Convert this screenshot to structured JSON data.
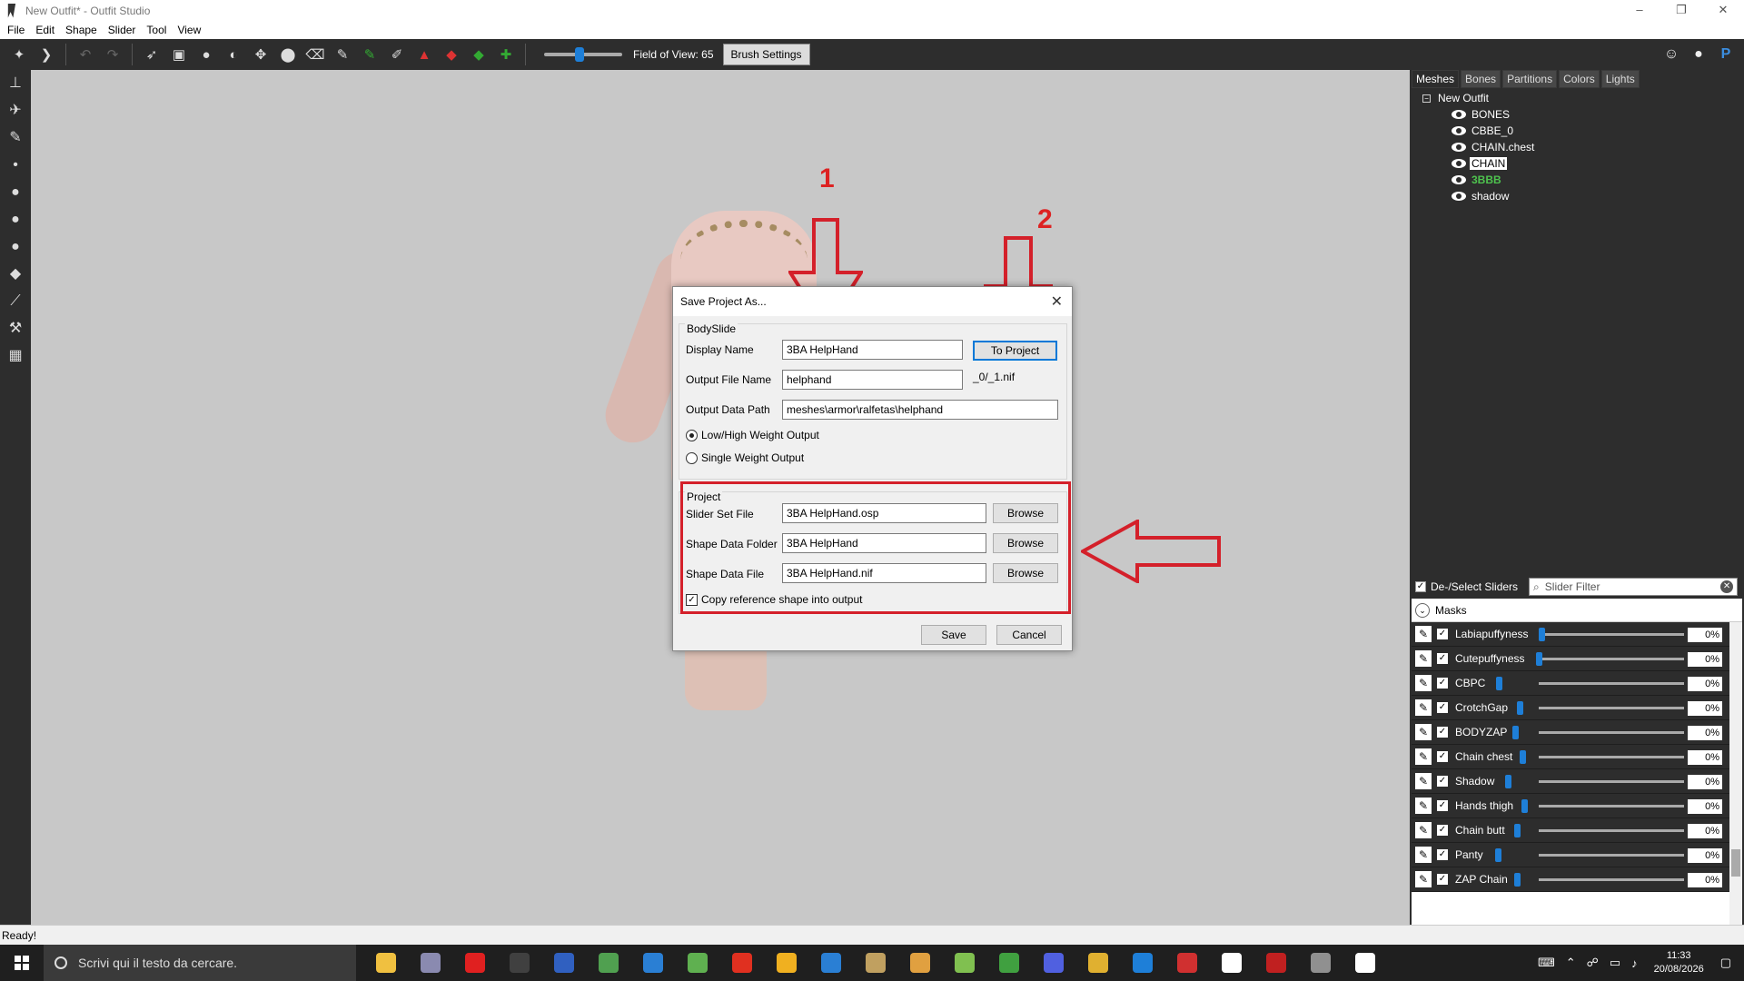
{
  "window": {
    "title": "New Outfit* - Outfit Studio",
    "minimize": "–",
    "restore": "❐",
    "close": "✕"
  },
  "menu": [
    "File",
    "Edit",
    "Shape",
    "Slider",
    "Tool",
    "View"
  ],
  "toolbar": {
    "fov_label": "Field of View: 65",
    "fov_value": 65,
    "brush_settings": "Brush Settings"
  },
  "tabs": [
    "Meshes",
    "Bones",
    "Partitions",
    "Colors",
    "Lights"
  ],
  "active_tab": "Meshes",
  "mesh_tree": {
    "root": "New Outfit",
    "meshes": [
      {
        "name": "BONES",
        "state": "normal"
      },
      {
        "name": "CBBE_0",
        "state": "normal"
      },
      {
        "name": "CHAIN.chest",
        "state": "normal"
      },
      {
        "name": "CHAIN",
        "state": "selected"
      },
      {
        "name": "3BBB",
        "state": "green"
      },
      {
        "name": "shadow",
        "state": "normal"
      }
    ]
  },
  "slider_panel": {
    "select_label": "De-/Select Sliders",
    "filter_placeholder": "Slider Filter",
    "masks_label": "Masks",
    "sliders": [
      {
        "name": "Labiapuffyness",
        "value": "0%",
        "pos": 0
      },
      {
        "name": "Cutepuffyness",
        "value": "0%",
        "pos": 0
      },
      {
        "name": "CBPC",
        "value": "0%",
        "pos": 0
      },
      {
        "name": "CrotchGap",
        "value": "0%",
        "pos": 0
      },
      {
        "name": "BODYZAP",
        "value": "0%",
        "pos": 0
      },
      {
        "name": "Chain chest",
        "value": "0%",
        "pos": 0
      },
      {
        "name": "Shadow",
        "value": "0%",
        "pos": 0
      },
      {
        "name": "Hands thigh",
        "value": "0%",
        "pos": 0
      },
      {
        "name": "Chain butt",
        "value": "0%",
        "pos": 0
      },
      {
        "name": "Panty",
        "value": "0%",
        "pos": 0
      },
      {
        "name": "ZAP Chain",
        "value": "0%",
        "pos": 0
      }
    ]
  },
  "status": {
    "text": "Ready!"
  },
  "dialog": {
    "title": "Save Project As...",
    "bodyslide_group": "BodySlide",
    "display_name_label": "Display Name",
    "display_name_value": "3BA HelpHand",
    "to_project": "To Project",
    "output_file_label": "Output File Name",
    "output_file_value": "helphand",
    "output_suffix": "_0/_1.nif",
    "output_path_label": "Output Data Path",
    "output_path_value": "meshes\\armor\\ralfetas\\helphand",
    "radio_lowhigh": "Low/High Weight Output",
    "radio_single": "Single Weight Output",
    "project_group": "Project",
    "slider_set_label": "Slider Set File",
    "slider_set_value": "3BA HelpHand.osp",
    "shape_folder_label": "Shape Data Folder",
    "shape_folder_value": "3BA HelpHand",
    "shape_file_label": "Shape Data File",
    "shape_file_value": "3BA HelpHand.nif",
    "browse": "Browse",
    "copy_ref": "Copy reference shape into output",
    "save": "Save",
    "cancel": "Cancel"
  },
  "annotations": {
    "n1": "1",
    "n2": "2",
    "color": "#d4202a"
  },
  "taskbar": {
    "search_placeholder": "Scrivi qui il testo da cercare.",
    "time": "11:33",
    "date": "20/08/2026",
    "app_colors": [
      "#f0c040",
      "#8a8ab0",
      "#e02020",
      "#404040",
      "#3060c0",
      "#50a050",
      "#2a7fd4",
      "#5fb050",
      "#e03020",
      "#f0b020",
      "#2a7fd4",
      "#c0a060",
      "#e0a040",
      "#80c050",
      "#40a040",
      "#5060e0",
      "#e0b030",
      "#1e7fd8",
      "#d03030",
      "#ffffff",
      "#c02020",
      "#909090",
      "#ffffff"
    ]
  }
}
